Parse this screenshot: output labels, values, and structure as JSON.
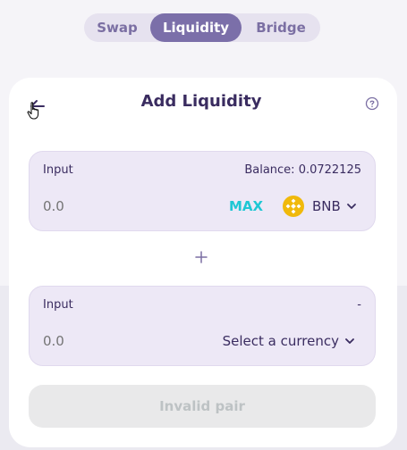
{
  "tabs": [
    {
      "label": "Swap"
    },
    {
      "label": "Liquidity"
    },
    {
      "label": "Bridge"
    }
  ],
  "header": {
    "title": "Add Liquidity"
  },
  "input_a": {
    "label": "Input",
    "balance": "Balance: 0.0722125",
    "placeholder": "0.0",
    "max_label": "MAX",
    "token_symbol": "BNB",
    "token_icon": "bnb-coin-icon"
  },
  "input_b": {
    "label": "Input",
    "balance": "-",
    "placeholder": "0.0",
    "select_label": "Select a currency"
  },
  "submit": {
    "label": "Invalid pair"
  },
  "colors": {
    "active_tab": "#7b6fa9",
    "accent_max": "#1fc7d4",
    "title": "#3a2c60",
    "panel_bg": "#ede8f6",
    "bnb": "#f0b90b"
  }
}
